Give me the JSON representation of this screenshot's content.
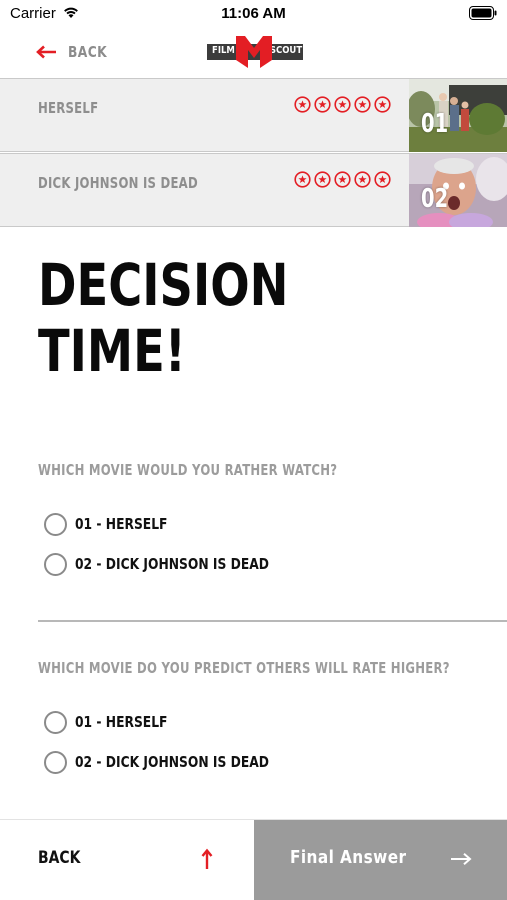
{
  "status_bar": {
    "carrier": "Carrier",
    "time": "11:06 AM"
  },
  "nav": {
    "back_label": "BACK",
    "logo_left": "FILM",
    "logo_right": "SCOUT",
    "icons": [
      "back-arrow-icon",
      "film-scout-logo"
    ]
  },
  "colors": {
    "accent": "#e31e24",
    "muted_text": "#8e8e8e",
    "row_bg": "#efefef",
    "final_button_bg": "#9b9b9b"
  },
  "movies": [
    {
      "title": "HERSELF",
      "number": "01",
      "rating_icons": 5
    },
    {
      "title": "DICK JOHNSON IS DEAD",
      "number": "02",
      "rating_icons": 5
    }
  ],
  "heading": {
    "line1": "DECISION",
    "line2": "TIME!"
  },
  "questions": [
    {
      "label": "WHICH MOVIE WOULD YOU RATHER WATCH?",
      "options": [
        "01 - HERSELF",
        "02 - DICK JOHNSON IS DEAD"
      ]
    },
    {
      "label": "WHICH MOVIE DO YOU PREDICT OTHERS WILL RATE HIGHER?",
      "options": [
        "01 - HERSELF",
        "02 - DICK JOHNSON IS DEAD"
      ]
    }
  ],
  "bottom": {
    "back_label": "BACK",
    "final_label": "Final Answer"
  }
}
